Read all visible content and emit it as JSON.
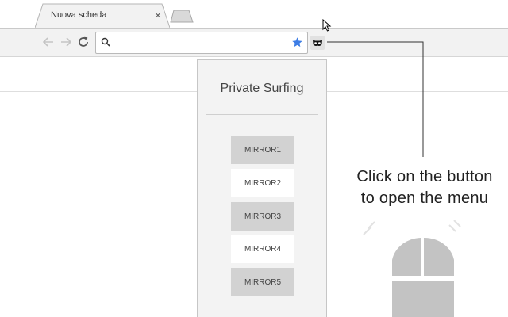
{
  "browser": {
    "tab": {
      "title": "Nuova scheda",
      "close_label": "×"
    },
    "toolbar": {
      "back_icon": "arrow-left-icon",
      "forward_icon": "arrow-right-icon",
      "reload_icon": "reload-icon",
      "omnibox": {
        "value": "",
        "placeholder": "",
        "search_icon": "magnifier-icon",
        "bookmark_icon": "star-icon"
      },
      "extension_icon": "mask-icon"
    }
  },
  "popup": {
    "title": "Private Surfing",
    "buttons": [
      {
        "label": "MIRROR1"
      },
      {
        "label": "MIRROR2"
      },
      {
        "label": "MIRROR3"
      },
      {
        "label": "MIRROR4"
      },
      {
        "label": "MIRROR5"
      }
    ]
  },
  "annotation": {
    "line1": "Click on the button",
    "line2": "to open the menu",
    "icon": "mouse-icon"
  },
  "colors": {
    "star": "#3d7de5",
    "button_dark": "#d2d2d2",
    "button_light": "#ffffff",
    "popup_bg": "#f3f3f3"
  }
}
